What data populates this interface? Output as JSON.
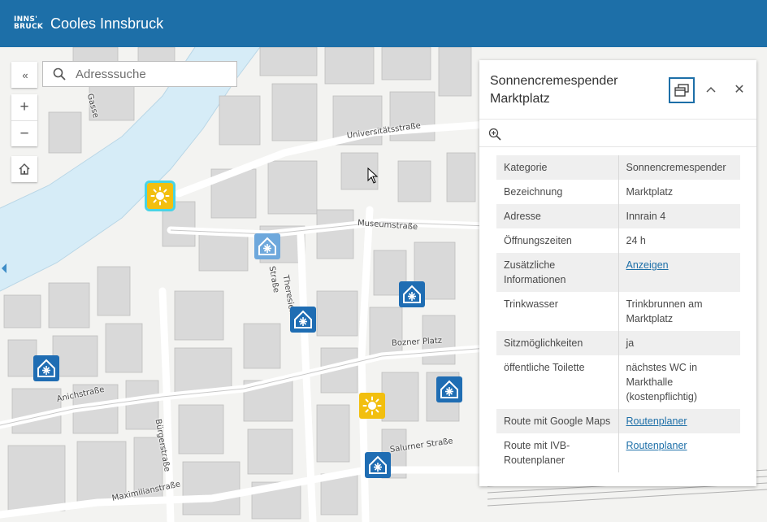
{
  "header": {
    "logo_line1": "INNS'",
    "logo_line2": "BRUCK",
    "title": "Cooles Innsbruck"
  },
  "map_controls": {
    "collapse_label": "«",
    "zoom_in_label": "+",
    "zoom_out_label": "−"
  },
  "search": {
    "placeholder": "Adresssuche"
  },
  "street_labels": {
    "universitaetsstrasse": "Universitätsstraße",
    "museumstrasse": "Museumstraße",
    "theresien": "Theresien",
    "strasse_upper": "Straße",
    "bozner_platz": "Bozner Platz",
    "anichstrasse": "Anichstraße",
    "buergerstrasse": "Bürgerstraße",
    "salurner_strasse": "Salurner Straße",
    "maximilianstrasse": "Maximilianstraße",
    "gasse": "Gasse"
  },
  "markers": [
    {
      "type": "sun",
      "icon": "sun-icon",
      "selected": true
    },
    {
      "type": "snow",
      "icon": "snowflake-house-icon",
      "light": true
    },
    {
      "type": "snow",
      "icon": "snowflake-house-icon"
    },
    {
      "type": "snow",
      "icon": "snowflake-house-icon"
    },
    {
      "type": "snow",
      "icon": "snowflake-house-icon"
    },
    {
      "type": "snow",
      "icon": "snowflake-house-icon"
    },
    {
      "type": "sun",
      "icon": "sun-icon"
    },
    {
      "type": "snow",
      "icon": "snowflake-house-icon"
    }
  ],
  "popup": {
    "title": "Sonnencremespender Marktplatz",
    "close_label": "✕",
    "rows": [
      {
        "key": "Kategorie",
        "value": "Sonnencremespender"
      },
      {
        "key": "Bezeichnung",
        "value": "Marktplatz"
      },
      {
        "key": "Adresse",
        "value": "Innrain 4"
      },
      {
        "key": "Öffnungszeiten",
        "value": "24 h"
      },
      {
        "key": "Zusätzliche Informationen",
        "value": "Anzeigen",
        "link": true
      },
      {
        "key": "Trinkwasser",
        "value": "Trinkbrunnen am Marktplatz"
      },
      {
        "key": "Sitzmöglichkeiten",
        "value": "ja"
      },
      {
        "key": "öffentliche Toilette",
        "value": "nächstes WC in Markthalle (kostenpflichtig)"
      },
      {
        "key": "Route mit Google Maps",
        "value": "Routenplaner",
        "link": true
      },
      {
        "key": "Route mit IVB-Routenplaner",
        "value": "Routenplaner",
        "link": true
      }
    ]
  },
  "colors": {
    "header_bg": "#1d6fa8",
    "river": "#d6ecf7",
    "marker_snow": "#1f6db3",
    "marker_sun": "#f2bf0f",
    "selection": "#49d3e6",
    "link": "#1d6fa8"
  }
}
